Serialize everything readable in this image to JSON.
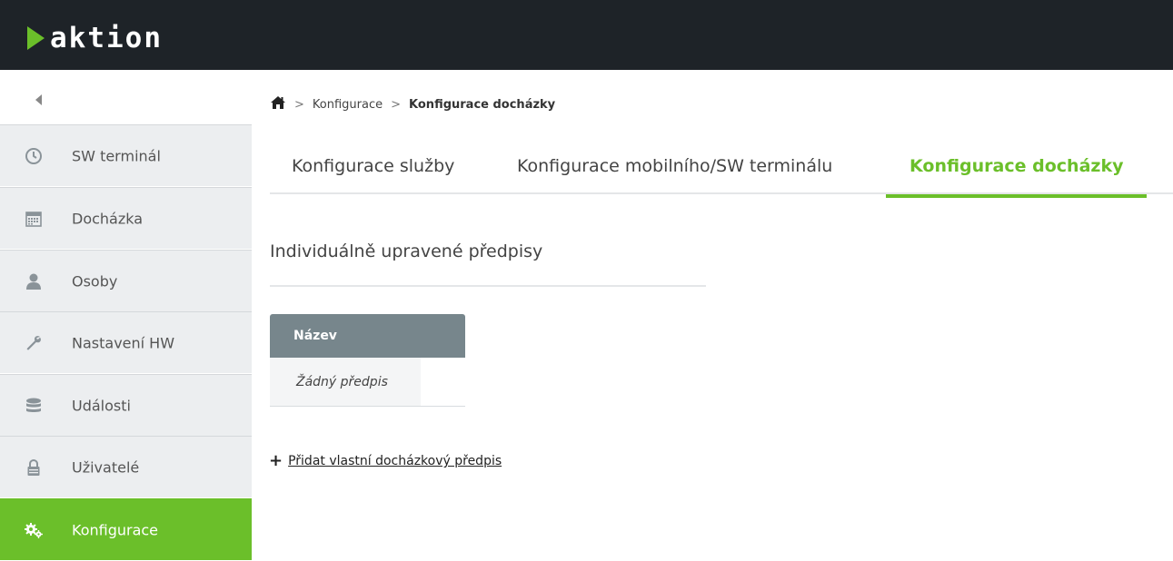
{
  "header": {
    "logo_text": "aktion",
    "brand_color": "#6bbf2a"
  },
  "sidebar": {
    "collapse_icon": "chevron-left-icon",
    "items": [
      {
        "label": "SW terminál",
        "icon": "clock-icon",
        "active": false
      },
      {
        "label": "Docházka",
        "icon": "calendar-icon",
        "active": false
      },
      {
        "label": "Osoby",
        "icon": "user-icon",
        "active": false
      },
      {
        "label": "Nastavení HW",
        "icon": "wrench-icon",
        "active": false
      },
      {
        "label": "Události",
        "icon": "database-icon",
        "active": false
      },
      {
        "label": "Uživatelé",
        "icon": "lock-icon",
        "active": false
      },
      {
        "label": "Konfigurace",
        "icon": "gears-icon",
        "active": true
      }
    ]
  },
  "breadcrumb": {
    "home_icon": "home-icon",
    "items": [
      "Konfigurace",
      "Konfigurace docházky"
    ]
  },
  "tabs": [
    {
      "label": "Konfigurace služby",
      "active": false
    },
    {
      "label": "Konfigurace mobilního/SW terminálu",
      "active": false
    },
    {
      "label": "Konfigurace docházky",
      "active": true
    }
  ],
  "main": {
    "section_title": "Individuálně upravené předpisy",
    "table": {
      "header": "Název",
      "empty_row": "Žádný předpis"
    },
    "add_link": "Přidat vlastní docházkový předpis"
  }
}
